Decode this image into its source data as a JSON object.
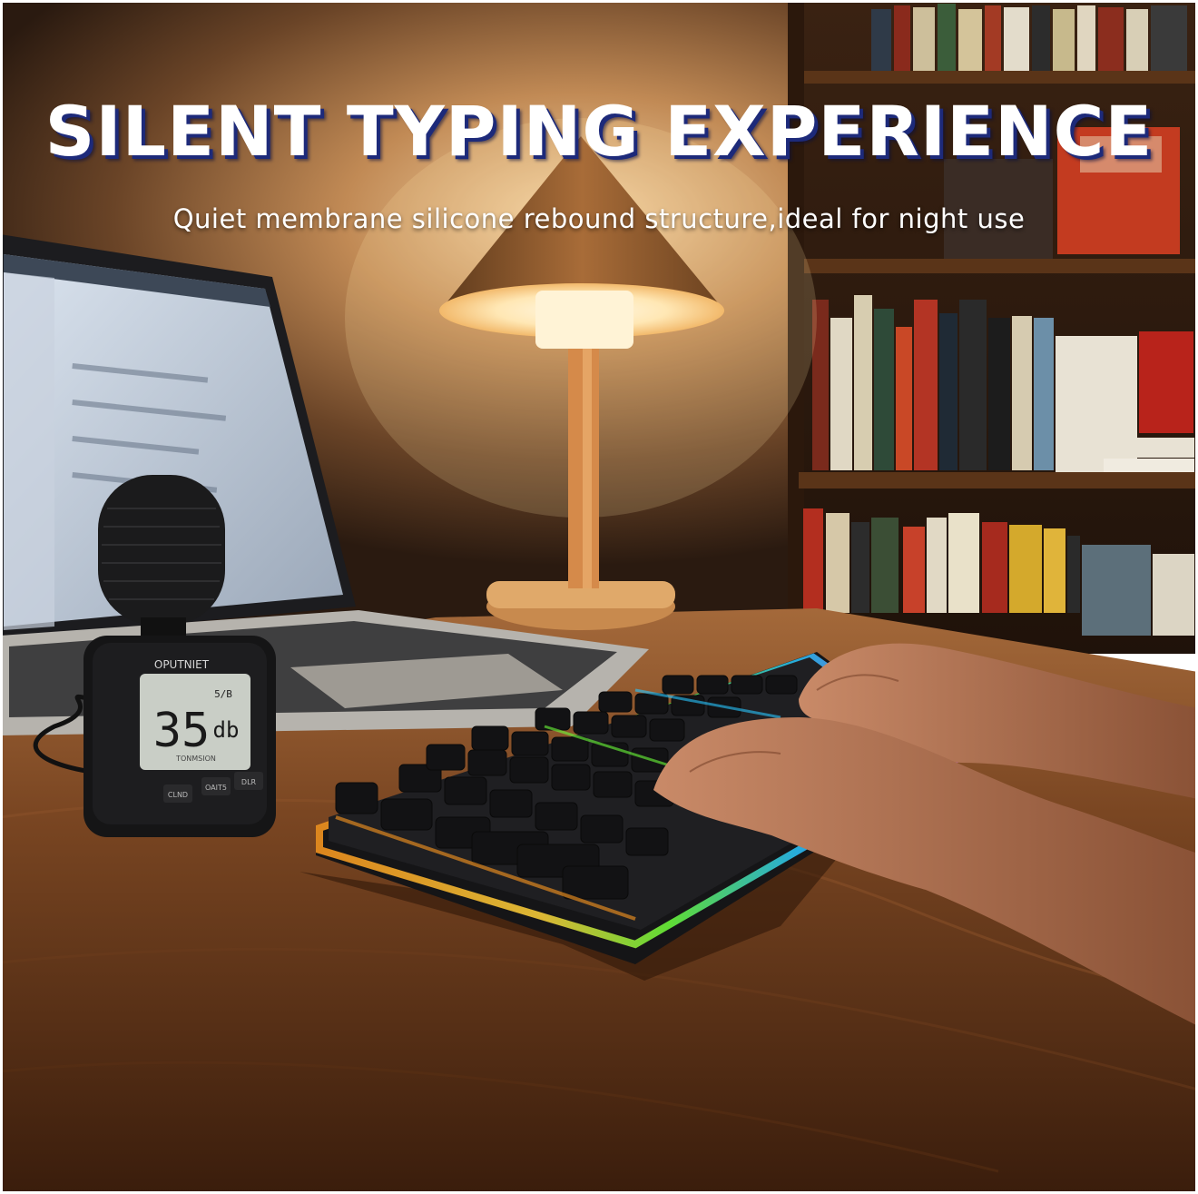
{
  "hero": {
    "title": "SILENT TYPING EXPERIENCE",
    "subtitle": "Quiet membrane silicone rebound structure,ideal for night use"
  },
  "sound_meter": {
    "brand": "OPUTNIET",
    "reading": "35",
    "unit": "db",
    "mode": "5/B",
    "sub_label": "TONMSION",
    "buttons": [
      "CLND",
      "OAIT5",
      "DLR"
    ]
  },
  "colors": {
    "title_shadow": "#1d2a7a",
    "lamp_glow": "#ffe2a8",
    "wall": "#6b4a2e",
    "desk": "#5e3519",
    "rgb_orange": "#ff9a1f",
    "rgb_green": "#6cff3a",
    "rgb_blue": "#29c6ff",
    "rgb_purple": "#c24bff"
  }
}
